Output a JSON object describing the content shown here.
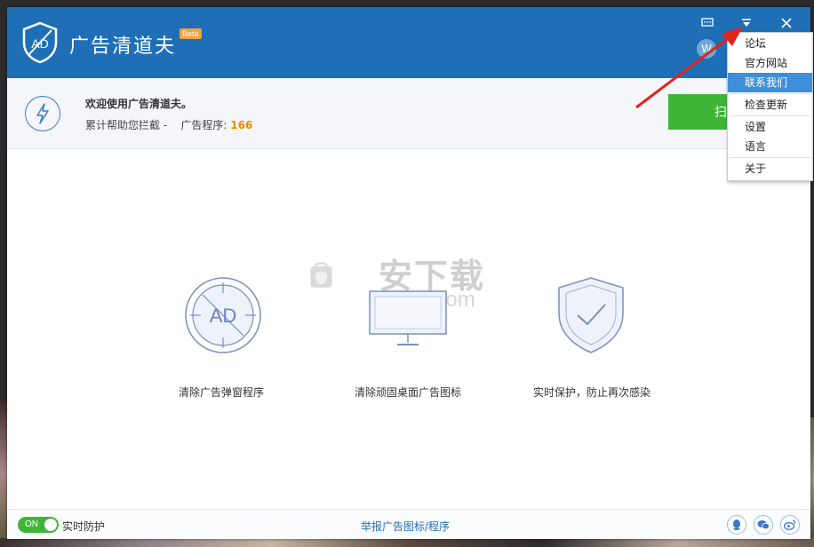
{
  "app": {
    "title": "广告清道夫",
    "beta_badge": "Beta",
    "avatar_letter": "W"
  },
  "colors": {
    "titlebar": "#1f6fb7",
    "accent_green": "#3fb538",
    "count_orange": "#f08a00",
    "menu_highlight": "#3d8fd9"
  },
  "info": {
    "welcome": "欢迎使用广告清道夫。",
    "stats_prefix": "累计帮助您拦截 -    广告程序: ",
    "ad_count": "166",
    "scan_button": "扫"
  },
  "features": [
    {
      "label": "清除广告弹窗程序",
      "icon": "ad-target-icon"
    },
    {
      "label": "清除顽固桌面广告图标",
      "icon": "monitor-icon"
    },
    {
      "label": "实时保护，防止再次感染",
      "icon": "shield-check-icon"
    }
  ],
  "watermark": {
    "text": "安下载",
    "sub": "anxz.com"
  },
  "status": {
    "toggle": "ON",
    "realtime_label": "实时防护",
    "report_link": "举报广告图标/程序"
  },
  "menu": {
    "items": [
      {
        "label": "论坛"
      },
      {
        "label": "官方网站"
      },
      {
        "label": "联系我们",
        "active": true
      },
      {
        "label": "检查更新"
      },
      {
        "label": "设置"
      },
      {
        "label": "语言"
      },
      {
        "label": "关于"
      }
    ]
  }
}
